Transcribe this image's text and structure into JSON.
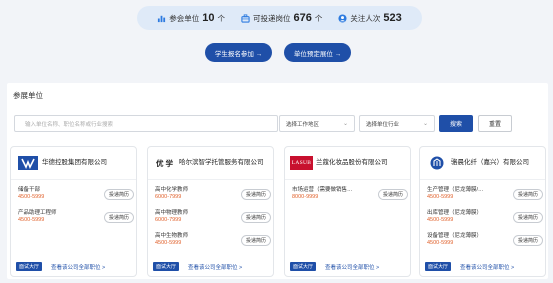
{
  "stats": {
    "units_label": "参会单位",
    "units_value": "10",
    "units_unit": "个",
    "jobs_label": "可投递岗位",
    "jobs_value": "676",
    "jobs_unit": "个",
    "follow_label": "关注人次",
    "follow_value": "523"
  },
  "actions": {
    "student_signup": "学生报名参加 →",
    "unit_book": "单位预定展位 →"
  },
  "section_title": "参展单位",
  "search": {
    "placeholder": "输入单位名称、职位名称或行业搜索",
    "area_select": "选择工作地区",
    "industry_select": "选择单位行业",
    "search_button": "搜索",
    "reset_button": "重置"
  },
  "common": {
    "deliver_label": "投递简历",
    "hall_tag": "面试大厅",
    "view_all": "查看该公司全部职位 >"
  },
  "companies": [
    {
      "name": "华德控股集团有限公司",
      "logo_text": "",
      "jobs": [
        {
          "title": "储备干部",
          "salary": "4500-5999"
        },
        {
          "title": "产品助理工程师",
          "salary": "4500-5999"
        }
      ]
    },
    {
      "name": "哈尔滨智学托管服务有限公司",
      "logo_text": "优 学",
      "jobs": [
        {
          "title": "高中化学教师",
          "salary": "6000-7999"
        },
        {
          "title": "高中物理教师",
          "salary": "6000-7999"
        },
        {
          "title": "高中生物教师",
          "salary": "4500-5999"
        }
      ]
    },
    {
      "name": "兰蔻化妆品股份有限公司",
      "logo_text": "LASUB",
      "jobs": [
        {
          "title": "市场运营（需要做销售…",
          "salary": "8000-9999"
        }
      ]
    },
    {
      "name": "骆晨化纤（嘉兴）有限公司",
      "logo_text": "",
      "jobs": [
        {
          "title": "生产管理（尼龙薄膜/…",
          "salary": "4500-5999"
        },
        {
          "title": "出库管理（尼龙薄膜）",
          "salary": "4500-5999"
        },
        {
          "title": "设备管理（尼龙薄膜）",
          "salary": "4500-5999"
        }
      ]
    }
  ],
  "colors": {
    "primary": "#1f4fa8",
    "salary": "#e0602a",
    "stats_bg": "#dfeaf8"
  }
}
